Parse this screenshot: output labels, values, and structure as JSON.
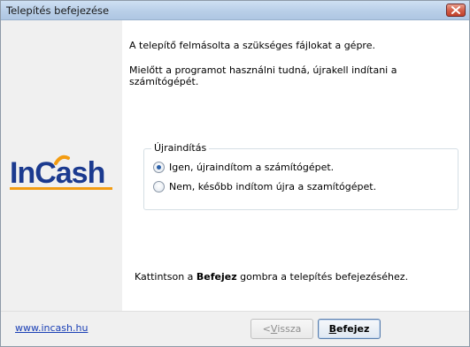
{
  "window": {
    "title": "Telepítés befejezése"
  },
  "content": {
    "line1": "A telepítő felmásolta a szükséges fájlokat a gépre.",
    "line2": "Mielőtt a programot használni tudná, újrakell indítani a számítógépét.",
    "group": {
      "legend": "Újraindítás",
      "options": [
        {
          "label": "Igen, újraindítom a számítógépet.",
          "checked": true
        },
        {
          "label": "Nem, később indítom újra a szamítógépet.",
          "checked": false
        }
      ]
    },
    "finish_note": {
      "prefix": "Kattintson a ",
      "bold": "Befejez",
      "suffix": " gombra a telepítés befejezéséhez."
    }
  },
  "logo": {
    "text": "InCash",
    "colors": {
      "blue": "#1b3a8f",
      "orange": "#f39c12"
    }
  },
  "footer": {
    "link": "www.incash.hu",
    "back_button": {
      "prefix": "< ",
      "underline": "V",
      "rest": "issza"
    },
    "finish_button": {
      "underline": "B",
      "rest": "efejez"
    }
  },
  "icons": {
    "close": "close-icon"
  }
}
